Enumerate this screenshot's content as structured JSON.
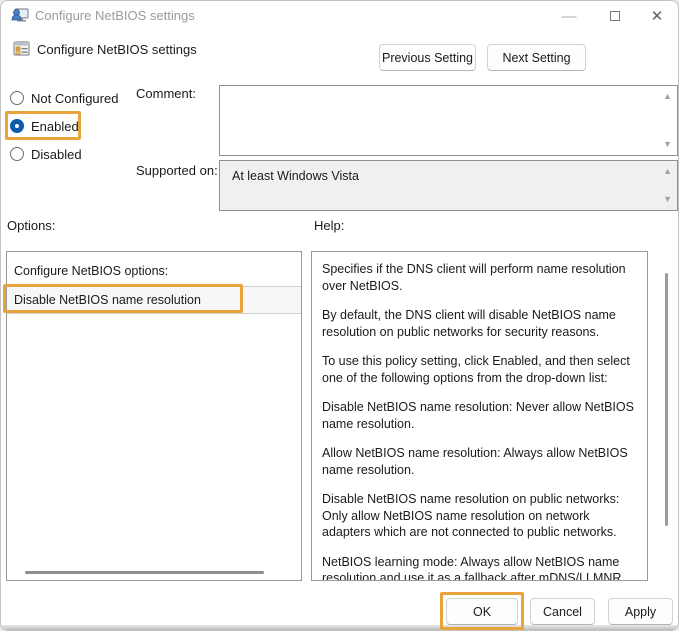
{
  "window": {
    "title": "Configure NetBIOS settings",
    "controls": {
      "minimize": "—",
      "close": "✕"
    }
  },
  "policy": {
    "name": "Configure NetBIOS settings"
  },
  "nav": {
    "previous": "Previous Setting",
    "next": "Next Setting"
  },
  "state_options": [
    {
      "label": "Not Configured",
      "selected": false
    },
    {
      "label": "Enabled",
      "selected": true
    },
    {
      "label": "Disabled",
      "selected": false
    }
  ],
  "comment": {
    "label": "Comment:",
    "value": ""
  },
  "supported": {
    "label": "Supported on:",
    "value": "At least Windows Vista"
  },
  "options_panel": {
    "label": "Options:",
    "dropdown_label": "Configure NetBIOS options:",
    "selected_option": "Disable NetBIOS name resolution"
  },
  "help_panel": {
    "label": "Help:",
    "paragraphs": [
      "Specifies if the DNS client will perform name resolution over NetBIOS.",
      "By default, the DNS client will disable NetBIOS name resolution on public networks for security reasons.",
      "To use this policy setting, click Enabled, and then select one of the following options from the drop-down list:",
      "Disable NetBIOS name resolution: Never allow NetBIOS name resolution.",
      "Allow NetBIOS name resolution: Always allow NetBIOS name resolution.",
      "Disable NetBIOS name resolution on public networks: Only allow NetBIOS name resolution on network adapters which are not connected to public networks.",
      "NetBIOS learning mode: Always allow NetBIOS name resolution and use it as a fallback after mDNS/LLMNR queries fail."
    ]
  },
  "footer": {
    "ok": "OK",
    "cancel": "Cancel",
    "apply": "Apply"
  },
  "colors": {
    "annotation_orange": "#e8a33d",
    "radio_accent": "#0b5cab"
  }
}
